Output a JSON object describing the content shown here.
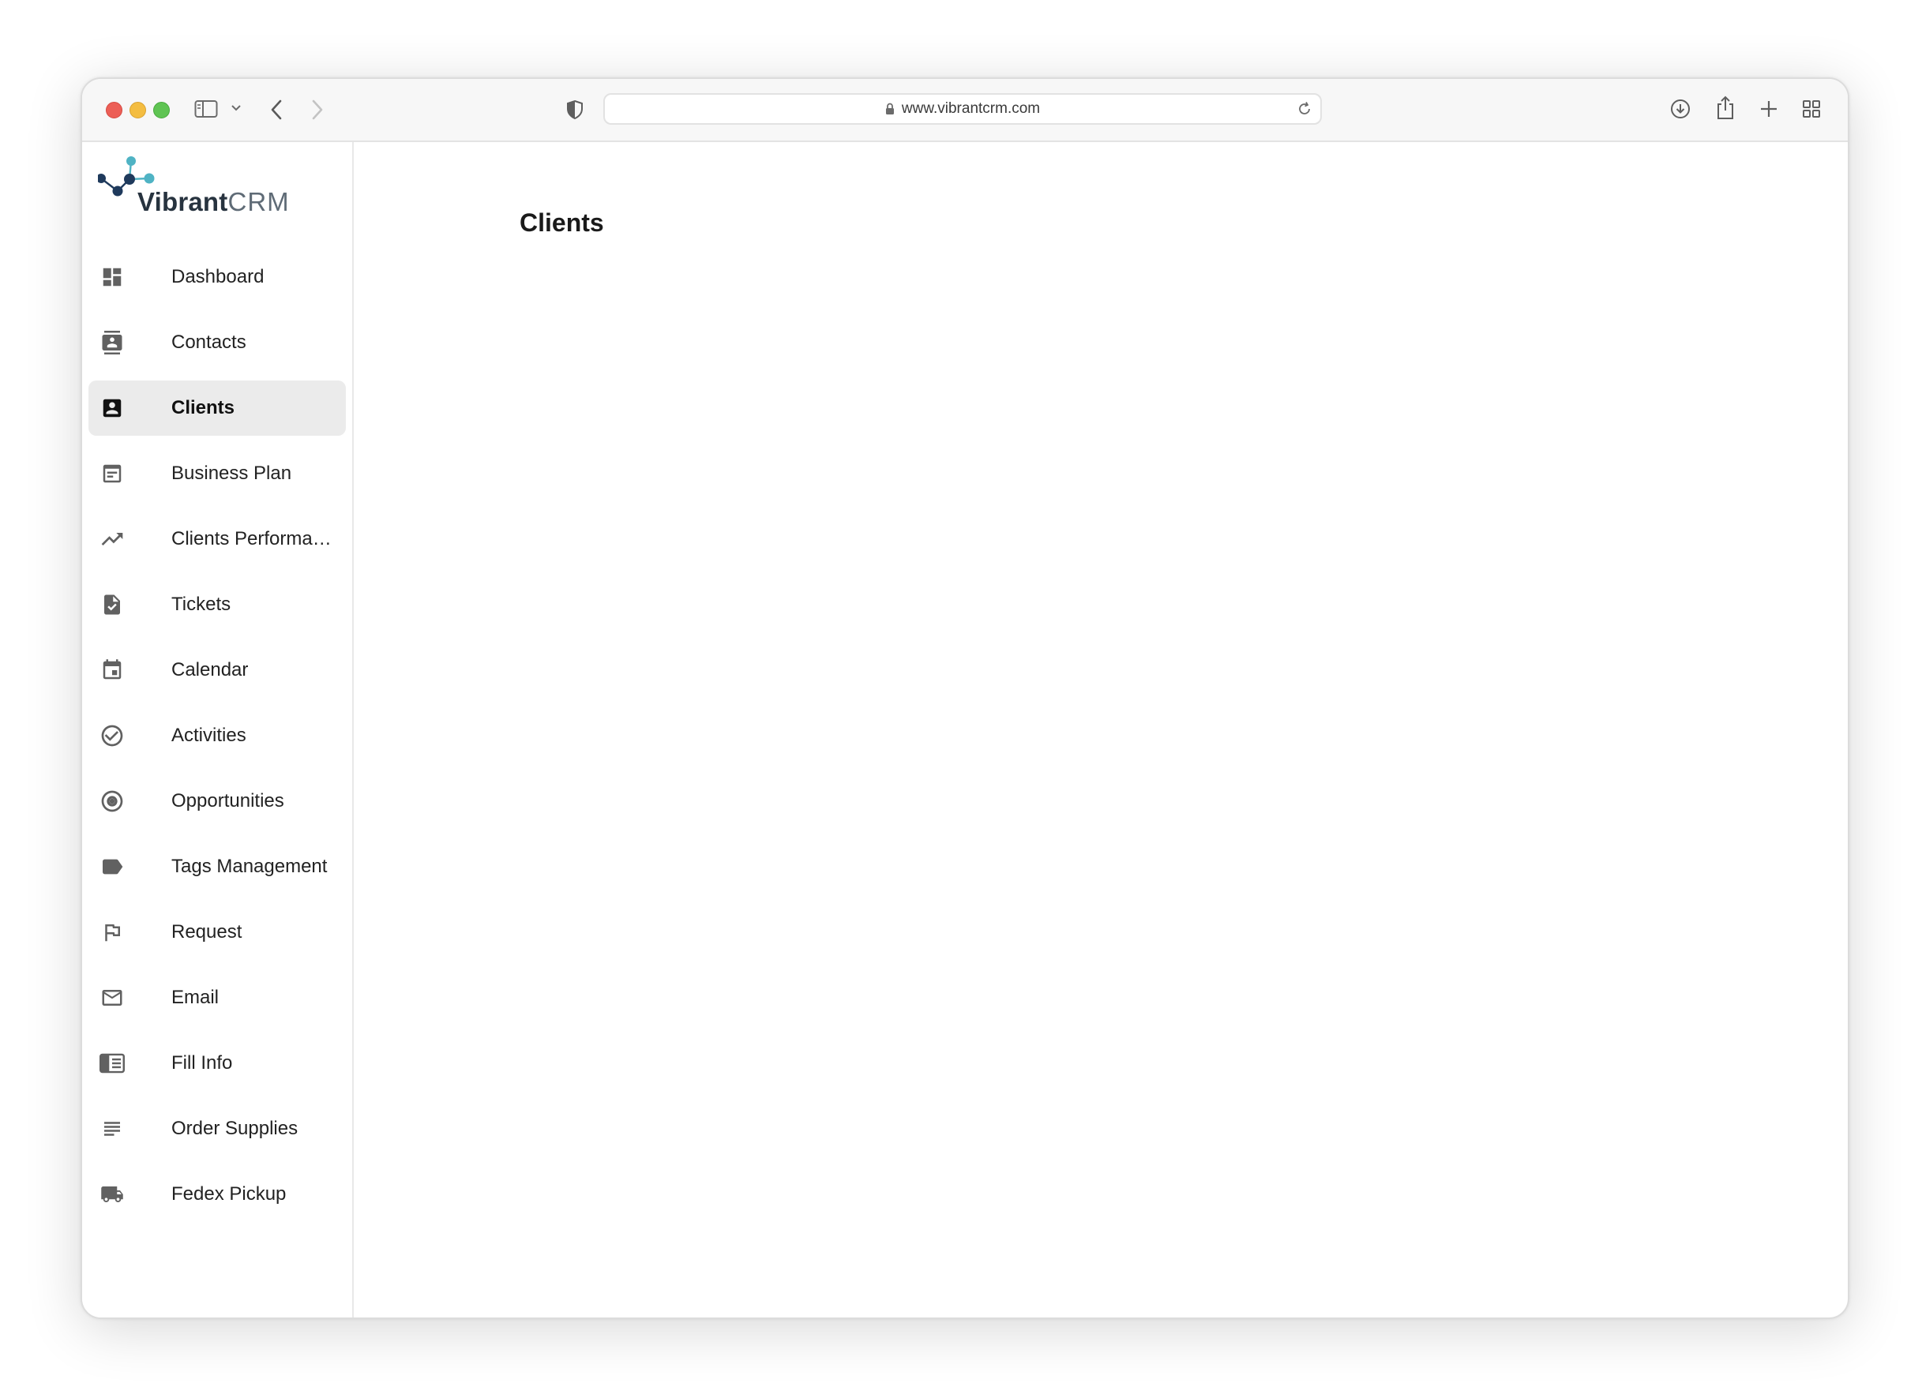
{
  "browser": {
    "url": "www.vibrantcrm.com"
  },
  "logo": {
    "brand": "Vibrant",
    "suffix": "CRM"
  },
  "sidebar": {
    "items": [
      {
        "label": "Dashboard",
        "icon": "dashboard-icon",
        "active": false
      },
      {
        "label": "Contacts",
        "icon": "contacts-icon",
        "active": false
      },
      {
        "label": "Clients",
        "icon": "clients-icon",
        "active": true
      },
      {
        "label": "Business Plan",
        "icon": "business-plan-icon",
        "active": false
      },
      {
        "label": "Clients Performance",
        "icon": "trending-up-icon",
        "active": false
      },
      {
        "label": "Tickets",
        "icon": "ticket-icon",
        "active": false
      },
      {
        "label": "Calendar",
        "icon": "calendar-icon",
        "active": false
      },
      {
        "label": "Activities",
        "icon": "check-circle-icon",
        "active": false
      },
      {
        "label": "Opportunities",
        "icon": "radio-button-icon",
        "active": false
      },
      {
        "label": "Tags Management",
        "icon": "tag-icon",
        "active": false
      },
      {
        "label": "Request",
        "icon": "flag-icon",
        "active": false
      },
      {
        "label": "Email",
        "icon": "mail-icon",
        "active": false
      },
      {
        "label": "Fill Info",
        "icon": "form-icon",
        "active": false
      },
      {
        "label": "Order Supplies",
        "icon": "lines-icon",
        "active": false
      },
      {
        "label": "Fedex Pickup",
        "icon": "truck-icon",
        "active": false
      }
    ]
  },
  "main": {
    "title": "Clients"
  },
  "colors": {
    "active_bg": "#ebebeb",
    "icon_gray": "#616161",
    "logo_teal": "#4fb3c4",
    "logo_navy": "#1f3a5c"
  }
}
